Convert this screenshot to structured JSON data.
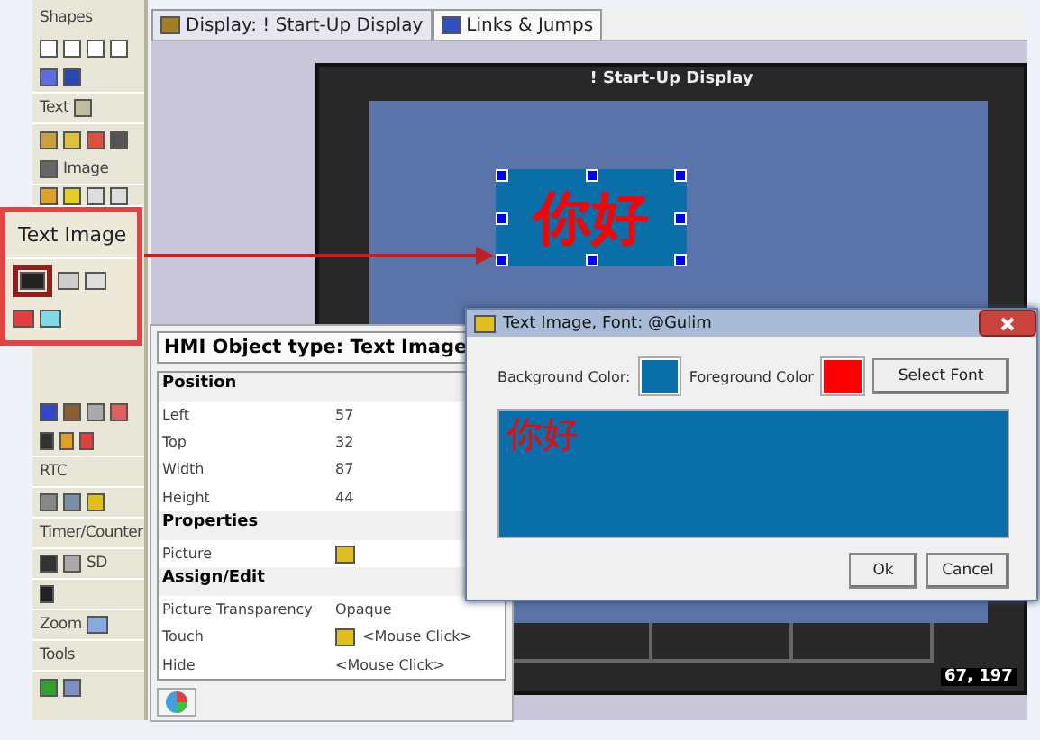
{
  "toolbox": {
    "labels": [
      "Shapes",
      "Text",
      "Image",
      "RTC",
      "Timer/Counter",
      "SD",
      "Zoom",
      "Tools"
    ]
  },
  "callout": {
    "title": "Text Image"
  },
  "tabs": [
    {
      "label": "Display: ! Start-Up Display",
      "selected": true
    },
    {
      "label": "Links & Jumps",
      "selected": false
    }
  ],
  "display": {
    "title": "! Start-Up Display",
    "text_image": "你好",
    "cursor_position": "67, 197"
  },
  "properties": {
    "title": "HMI Object type: Text Image",
    "sections": [
      {
        "title": "Position",
        "rows": [
          {
            "name": "Left",
            "value": "57"
          },
          {
            "name": "Top",
            "value": "32"
          },
          {
            "name": "Width",
            "value": "87"
          },
          {
            "name": "Height",
            "value": "44"
          }
        ]
      },
      {
        "title": "Properties",
        "rows": [
          {
            "name": "Picture",
            "icon": true
          }
        ]
      },
      {
        "title": "Assign/Edit",
        "rows": [
          {
            "name": "Picture Transparency",
            "value": "Opaque"
          },
          {
            "name": "Touch",
            "icon": true,
            "value": "<Mouse Click>"
          },
          {
            "name": "Hide",
            "value": "<Mouse Click>"
          }
        ]
      }
    ]
  },
  "dialog": {
    "title": "Text Image, Font: @Gulim",
    "background_label": "Background Color:",
    "foreground_label": "Foreground Color",
    "select_font": "Select Font",
    "preview_text": "你好",
    "buttons": [
      "Ok",
      "Cancel"
    ]
  }
}
